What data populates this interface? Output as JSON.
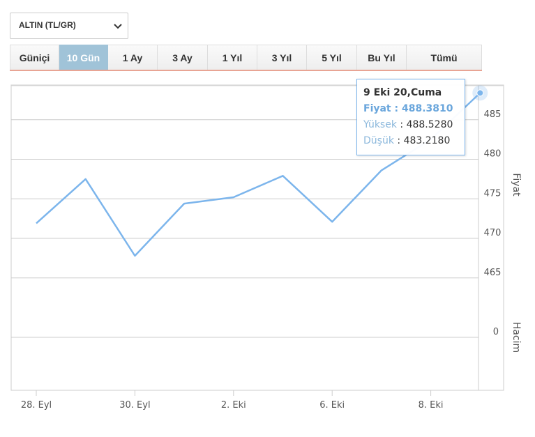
{
  "selector": {
    "label": "ALTIN (TL/GR)",
    "icon": "chevron-down-icon"
  },
  "tabs": [
    {
      "label": "Güniçi"
    },
    {
      "label": "10 Gün",
      "active": true
    },
    {
      "label": "1 Ay"
    },
    {
      "label": "3 Ay"
    },
    {
      "label": "1 Yıl"
    },
    {
      "label": "3 Yıl"
    },
    {
      "label": "5 Yıl"
    },
    {
      "label": "Bu Yıl"
    },
    {
      "label": "Tümü"
    }
  ],
  "tooltip": {
    "date": "9 Eki 20,Cuma",
    "price_label": "Fiyat",
    "price_value": "488.3810",
    "high_label": "Yüksek",
    "high_value": "488.5280",
    "low_label": "Düşük",
    "low_value": "483.2180"
  },
  "chart_data": {
    "type": "line",
    "x_labels": [
      "28. Eyl",
      "30. Eyl",
      "2. Eki",
      "6. Eki",
      "8. Eki"
    ],
    "x": [
      "28. Eyl",
      "29. Eyl",
      "30. Eyl",
      "1. Eki",
      "2. Eki",
      "5. Eki",
      "6. Eki",
      "7. Eki",
      "8. Eki",
      "9. Eki"
    ],
    "series": [
      {
        "values": [
          471.9,
          477.5,
          467.8,
          474.4,
          475.2,
          477.9,
          472.1,
          478.6,
          482.5,
          488.381
        ]
      }
    ],
    "price_axis": {
      "label": "Fiyat",
      "ticks": [
        465,
        470,
        475,
        480,
        485
      ],
      "ylim": [
        461,
        490
      ]
    },
    "volume_axis": {
      "label": "Hacim",
      "ticks": [
        0
      ]
    },
    "grid": true,
    "colors": {
      "line": "#7cb5ec",
      "grid": "#cccccc",
      "active_tab": "#a0c3d8"
    }
  }
}
